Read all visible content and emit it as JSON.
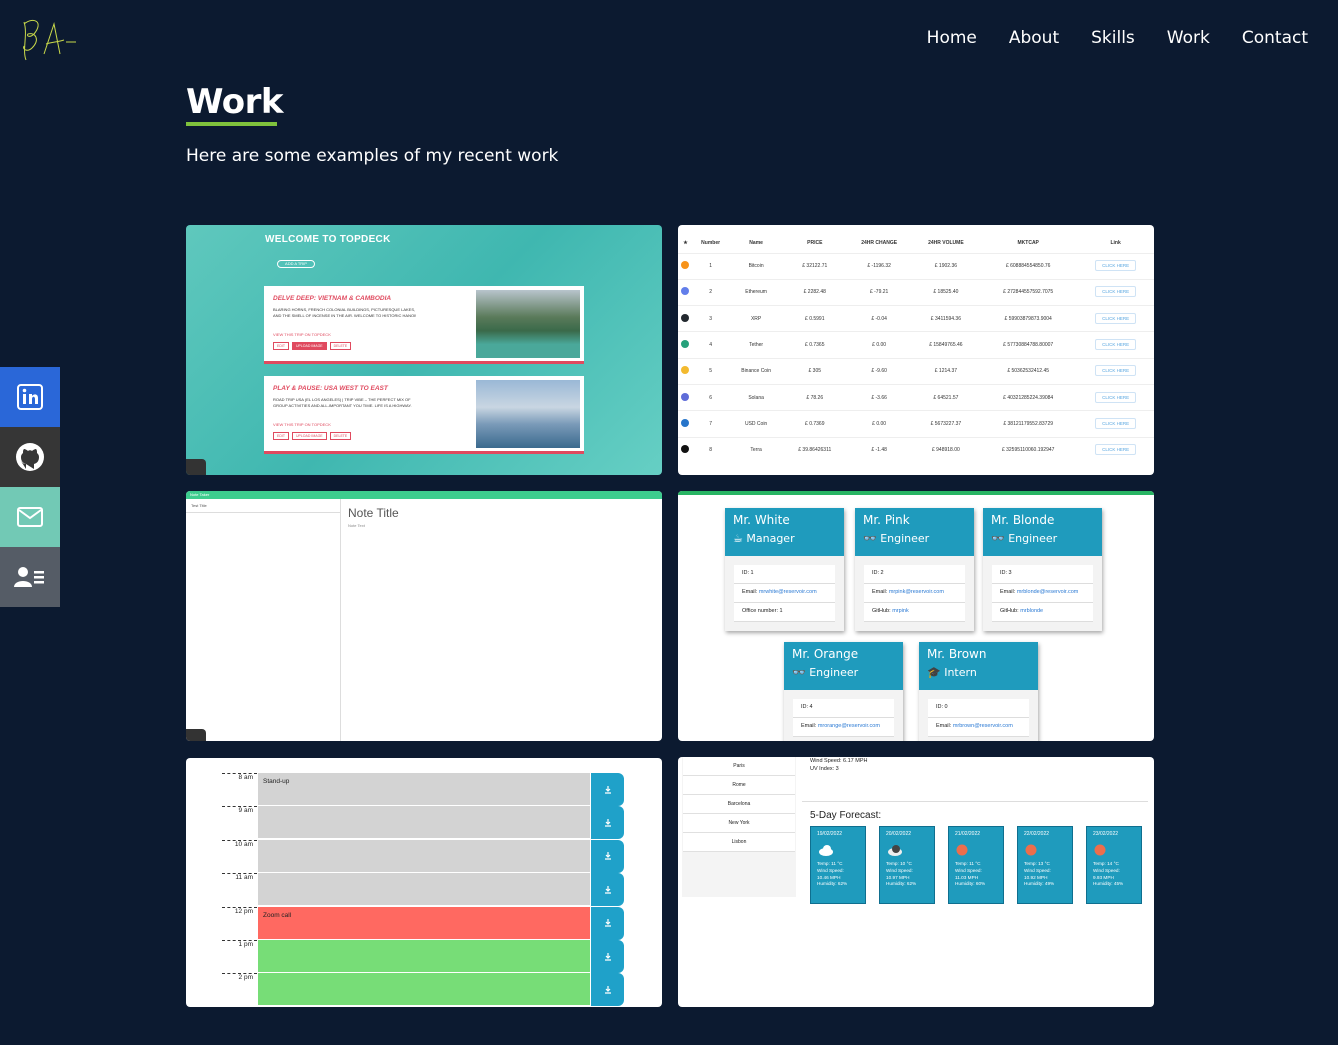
{
  "nav": [
    "Home",
    "About",
    "Skills",
    "Work",
    "Contact"
  ],
  "page": {
    "title": "Work",
    "subtitle": "Here are some examples of my recent work"
  },
  "topdeck": {
    "title": "WELCOME TO TOPDECK",
    "add_button": "ADD A TRIP",
    "trips": [
      {
        "title": "DELVE DEEP: VIETNAM & CAMBODIA",
        "desc": "BLARING HORNS, FRENCH COLONIAL BUILDINGS, PICTURESQUE LAKES, AND THE SMELL OF INCENSE IN THE AIR. WELCOME TO HISTORIC HANOI!",
        "link": "VIEW THIS TRIP ON TOPDECK",
        "buttons": [
          "EDIT",
          "UPLOAD IMAGE",
          "DELETE"
        ]
      },
      {
        "title": "PLAY & PAUSE: USA WEST TO EAST",
        "desc": "ROAD TRIP USA (EL LOS ANGELES) | TRIP VIBE – THE PERFECT MIX OF GROUP ACTIVITIES AND ALL-IMPORTANT YOU TIME. LIFE IS A HIGHWAY.",
        "link": "VIEW THIS TRIP ON TOPDECK",
        "buttons": [
          "EDIT",
          "UPLOAD IMAGE",
          "DELETE"
        ]
      }
    ]
  },
  "crypto": {
    "headers": [
      "★",
      "Number",
      "Name",
      "PRICE",
      "24HR CHANGE",
      "24HR VOLUME",
      "MKTCAP",
      "Link"
    ],
    "link_label": "CLICK HERE",
    "rows": [
      {
        "n": "1",
        "name": "Bitcoin",
        "price": "£ 32122.71",
        "chg": "£ -1196.32",
        "vol": "£ 1902.36",
        "cap": "£ 608884554850.76",
        "color": "#f7931a"
      },
      {
        "n": "2",
        "name": "Ethereum",
        "price": "£ 2282.48",
        "chg": "£ -79.21",
        "vol": "£ 18525.40",
        "cap": "£ 272844557592.7075",
        "color": "#627eea"
      },
      {
        "n": "3",
        "name": "XRP",
        "price": "£ 0.5991",
        "chg": "£ -0.04",
        "vol": "£ 3411594.36",
        "cap": "£ 59903879873.9004",
        "color": "#23292f"
      },
      {
        "n": "4",
        "name": "Tether",
        "price": "£ 0.7365",
        "chg": "£ 0.00",
        "vol": "£ 15849765.46",
        "cap": "£ 57730884788.80007",
        "color": "#26a17b"
      },
      {
        "n": "5",
        "name": "Binance Coin",
        "price": "£ 305",
        "chg": "£ -9.60",
        "vol": "£ 1214.37",
        "cap": "£ 50362532412.45",
        "color": "#f3ba2f"
      },
      {
        "n": "6",
        "name": "Solana",
        "price": "£ 78.26",
        "chg": "£ -3.66",
        "vol": "£ 64521.57",
        "cap": "£ 40321285224.39084",
        "color": "#5f6cd8"
      },
      {
        "n": "7",
        "name": "USD Coin",
        "price": "£ 0.7369",
        "chg": "£ 0.00",
        "vol": "£ 5673227.37",
        "cap": "£ 38121179552.83729",
        "color": "#2775ca"
      },
      {
        "n": "8",
        "name": "Terra",
        "price": "£ 39.86426311",
        "chg": "£ -1.48",
        "vol": "£ 948918.00",
        "cap": "£ 32595110060.192947",
        "color": "#111111"
      }
    ]
  },
  "notes": {
    "app": "Note Taker",
    "item": "Test Title",
    "title": "Note Title",
    "text": "Note Text"
  },
  "team": [
    {
      "name": "Mr. White",
      "role": "Manager",
      "id": "ID: 1",
      "email_label": "Email:",
      "email": "mrwhite@reservoir.com",
      "extra_label": "Office number: 1",
      "extra_link": ""
    },
    {
      "name": "Mr. Pink",
      "role": "Engineer",
      "id": "ID: 2",
      "email_label": "Email:",
      "email": "mrpink@reservoir.com",
      "extra_label": "GitHub:",
      "extra_link": "mrpink"
    },
    {
      "name": "Mr. Blonde",
      "role": "Engineer",
      "id": "ID: 3",
      "email_label": "Email:",
      "email": "mrblonde@reservoir.com",
      "extra_label": "GitHub:",
      "extra_link": "mrblonde"
    },
    {
      "name": "Mr. Orange",
      "role": "Engineer",
      "id": "ID: 4",
      "email_label": "Email:",
      "email": "mrorange@reservoir.com",
      "extra_label": "",
      "extra_link": ""
    },
    {
      "name": "Mr. Brown",
      "role": "Intern",
      "id": "ID: 0",
      "email_label": "Email:",
      "email": "mrbrown@reservoir.com",
      "extra_label": "",
      "extra_link": ""
    }
  ],
  "schedule": [
    {
      "hour": "8 am",
      "text": "Stand-up",
      "state": "past"
    },
    {
      "hour": "9 am",
      "text": "",
      "state": "past"
    },
    {
      "hour": "10 am",
      "text": "",
      "state": "past"
    },
    {
      "hour": "11 am",
      "text": "",
      "state": "past"
    },
    {
      "hour": "12 pm",
      "text": "Zoom call",
      "state": "present"
    },
    {
      "hour": "1 pm",
      "text": "",
      "state": "future"
    },
    {
      "hour": "2 pm",
      "text": "",
      "state": "future"
    }
  ],
  "weather": {
    "cities": [
      "Paris",
      "Rome",
      "Barcelona",
      "New York",
      "Lisbon"
    ],
    "current": [
      "Wind Speed: 6.17 MPH",
      "UV Index: 3"
    ],
    "forecast_title": "5-Day Forecast:",
    "days": [
      {
        "date": "19/02/2022",
        "icon": "cloud",
        "temp": "Temp: 11 °C",
        "wind": "Wind Speed:",
        "windv": "10.46 MPH",
        "hum": "Humidity: 62%"
      },
      {
        "date": "20/02/2022",
        "icon": "cloud-dark",
        "temp": "Temp: 10 °C",
        "wind": "Wind Speed:",
        "windv": "10.97 MPH",
        "hum": "Humidity: 62%"
      },
      {
        "date": "21/02/2022",
        "icon": "sun",
        "temp": "Temp: 11 °C",
        "wind": "Wind Speed:",
        "windv": "11.03 MPH",
        "hum": "Humidity: 60%"
      },
      {
        "date": "22/02/2022",
        "icon": "sun",
        "temp": "Temp: 13 °C",
        "wind": "Wind Speed:",
        "windv": "10.92 MPH",
        "hum": "Humidity: 49%"
      },
      {
        "date": "23/02/2022",
        "icon": "sun",
        "temp": "Temp: 14 °C",
        "wind": "Wind Speed:",
        "windv": "9.93 MPH",
        "hum": "Humidity: 45%"
      }
    ]
  }
}
